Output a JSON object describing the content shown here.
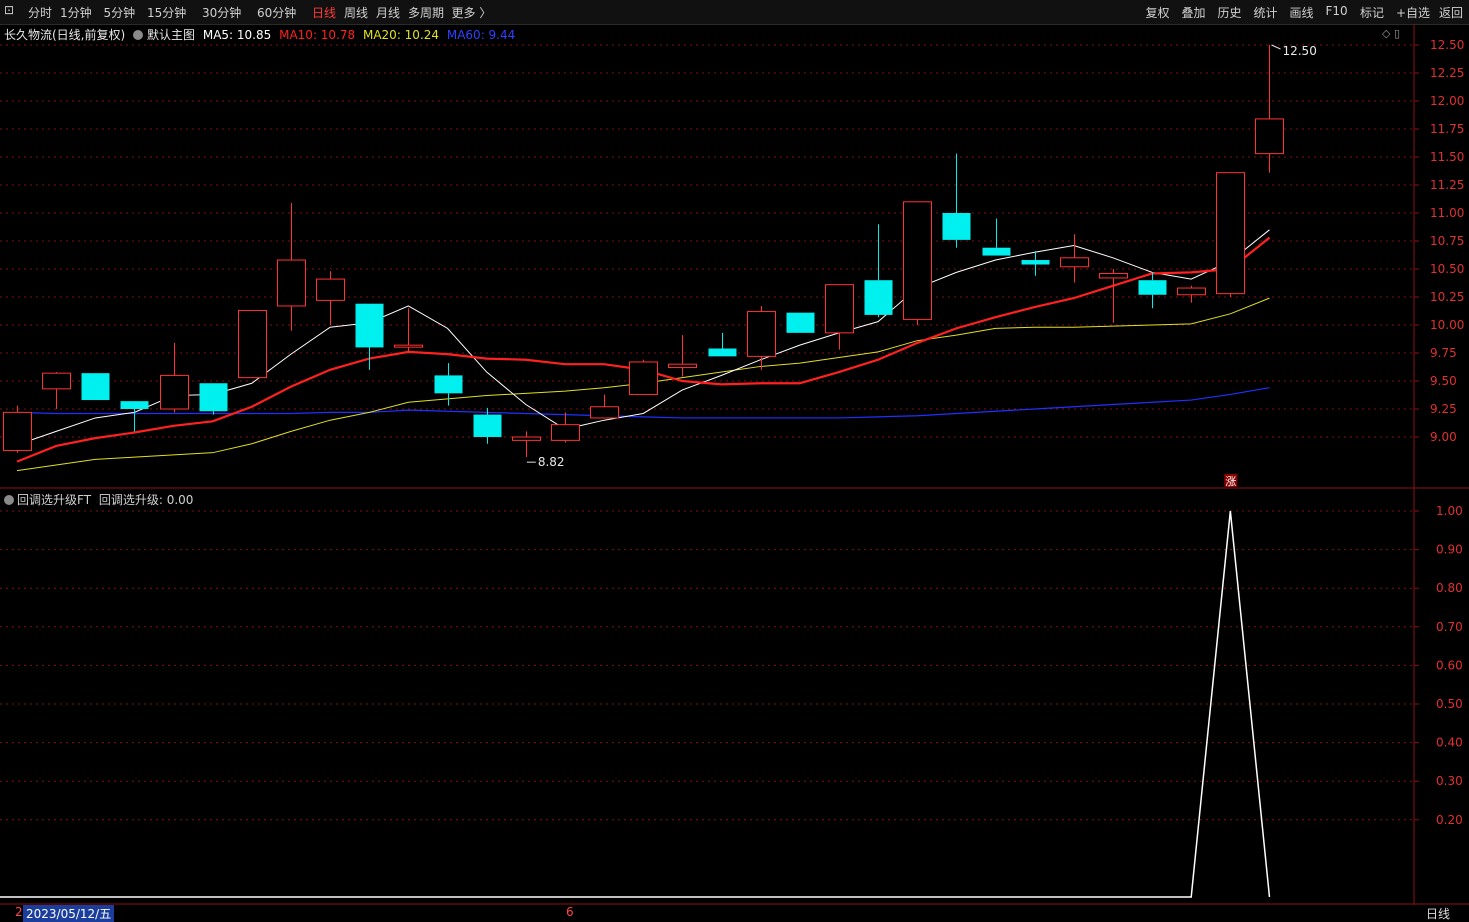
{
  "toolbar": {
    "periods": [
      "分时",
      "1分钟",
      "5分钟",
      "15分钟",
      "30分钟",
      "60分钟",
      "日线",
      "周线",
      "月线",
      "多周期",
      "更多 〉"
    ],
    "active_period": "日线",
    "right_buttons": [
      "复权",
      "叠加",
      "历史",
      "统计",
      "画线",
      "F10",
      "标记",
      "+自选",
      "返回"
    ]
  },
  "legend": {
    "stock": "长久物流(日线,前复权)",
    "template": "默认主图",
    "ma5": "MA5: 10.85",
    "ma10": "MA10: 10.78",
    "ma20": "MA20: 10.24",
    "ma60": "MA60: 9.44"
  },
  "indicator": {
    "name": "回调选升级FT",
    "value": "回调选升级: 0.00"
  },
  "annotations": {
    "high": "12.50",
    "low": "8.82",
    "signal": "涨"
  },
  "bottom": {
    "left_mark": "2",
    "date": "2023/05/12/五",
    "month_mark": "6",
    "period_label": "日线"
  },
  "colors": {
    "up": "#ff3232",
    "down": "#00f0f0",
    "ma5": "#ffffff",
    "ma10": "#ff2020",
    "ma20": "#e0e020",
    "ma60": "#2030ff",
    "border": "#8b1010"
  },
  "chart_data": [
    {
      "type": "candlestick",
      "y_ticks": [
        "12.50",
        "12.25",
        "12.00",
        "11.75",
        "11.50",
        "11.25",
        "11.00",
        "10.75",
        "10.50",
        "10.25",
        "10.00",
        "9.75",
        "9.50",
        "9.25",
        "9.00"
      ],
      "ylim": [
        8.7,
        12.55
      ],
      "candles": [
        {
          "o": 8.88,
          "c": 9.22,
          "h": 9.28,
          "l": 8.86
        },
        {
          "o": 9.43,
          "c": 9.57,
          "h": 9.58,
          "l": 9.25
        },
        {
          "o": 9.57,
          "c": 9.33,
          "h": 9.57,
          "l": 9.33
        },
        {
          "o": 9.32,
          "c": 9.25,
          "h": 9.32,
          "l": 9.05
        },
        {
          "o": 9.25,
          "c": 9.55,
          "h": 9.84,
          "l": 9.22
        },
        {
          "o": 9.48,
          "c": 9.23,
          "h": 9.48,
          "l": 9.2
        },
        {
          "o": 9.53,
          "c": 10.13,
          "h": 10.13,
          "l": 9.53
        },
        {
          "o": 10.17,
          "c": 10.58,
          "h": 11.09,
          "l": 9.95
        },
        {
          "o": 10.22,
          "c": 10.41,
          "h": 10.48,
          "l": 10.0
        },
        {
          "o": 10.19,
          "c": 9.8,
          "h": 10.19,
          "l": 9.6
        },
        {
          "o": 9.82,
          "c": 9.82,
          "h": 10.15,
          "l": 9.76
        },
        {
          "o": 9.55,
          "c": 9.39,
          "h": 9.66,
          "l": 9.28
        },
        {
          "o": 9.2,
          "c": 9.0,
          "h": 9.26,
          "l": 8.94
        },
        {
          "o": 8.97,
          "c": 9.0,
          "h": 9.05,
          "l": 8.82
        },
        {
          "o": 8.97,
          "c": 9.11,
          "h": 9.22,
          "l": 8.95
        },
        {
          "o": 9.17,
          "c": 9.27,
          "h": 9.38,
          "l": 9.17
        },
        {
          "o": 9.38,
          "c": 9.67,
          "h": 9.69,
          "l": 9.38
        },
        {
          "o": 9.62,
          "c": 9.65,
          "h": 9.91,
          "l": 9.54
        },
        {
          "o": 9.79,
          "c": 9.72,
          "h": 9.93,
          "l": 9.72
        },
        {
          "o": 9.72,
          "c": 10.12,
          "h": 10.17,
          "l": 9.6
        },
        {
          "o": 10.11,
          "c": 9.93,
          "h": 10.11,
          "l": 9.93
        },
        {
          "o": 9.93,
          "c": 10.36,
          "h": 10.36,
          "l": 9.78
        },
        {
          "o": 10.4,
          "c": 10.09,
          "h": 10.9,
          "l": 10.07
        },
        {
          "o": 10.05,
          "c": 11.1,
          "h": 11.1,
          "l": 10.0
        },
        {
          "o": 11.0,
          "c": 10.76,
          "h": 11.53,
          "l": 10.69
        },
        {
          "o": 10.69,
          "c": 10.62,
          "h": 10.95,
          "l": 10.62
        },
        {
          "o": 10.58,
          "c": 10.54,
          "h": 10.66,
          "l": 10.44
        },
        {
          "o": 10.52,
          "c": 10.6,
          "h": 10.81,
          "l": 10.38
        },
        {
          "o": 10.42,
          "c": 10.46,
          "h": 10.5,
          "l": 10.02
        },
        {
          "o": 10.4,
          "c": 10.27,
          "h": 10.47,
          "l": 10.15
        },
        {
          "o": 10.27,
          "c": 10.33,
          "h": 10.35,
          "l": 10.2
        },
        {
          "o": 10.28,
          "c": 11.36,
          "h": 11.36,
          "l": 10.25
        },
        {
          "o": 11.53,
          "c": 11.84,
          "h": 12.5,
          "l": 11.36
        }
      ],
      "ma5": [
        8.93,
        9.05,
        9.17,
        9.22,
        9.37,
        9.38,
        9.48,
        9.74,
        9.98,
        10.02,
        10.17,
        9.97,
        9.58,
        9.29,
        9.07,
        9.15,
        9.21,
        9.42,
        9.55,
        9.69,
        9.82,
        9.93,
        10.03,
        10.33,
        10.47,
        10.58,
        10.65,
        10.71,
        10.6,
        10.47,
        10.41,
        10.57,
        10.85
      ],
      "ma10": [
        8.78,
        8.92,
        8.99,
        9.04,
        9.1,
        9.14,
        9.27,
        9.45,
        9.6,
        9.7,
        9.76,
        9.74,
        9.7,
        9.69,
        9.65,
        9.65,
        9.6,
        9.5,
        9.47,
        9.48,
        9.48,
        9.58,
        9.69,
        9.84,
        9.97,
        10.07,
        10.16,
        10.24,
        10.35,
        10.46,
        10.47,
        10.5,
        10.78
      ],
      "ma20": [
        8.7,
        8.75,
        8.8,
        8.82,
        8.84,
        8.86,
        8.94,
        9.05,
        9.15,
        9.22,
        9.31,
        9.34,
        9.37,
        9.39,
        9.41,
        9.44,
        9.48,
        9.53,
        9.58,
        9.63,
        9.66,
        9.71,
        9.76,
        9.86,
        9.91,
        9.97,
        9.98,
        9.98,
        9.99,
        10.0,
        10.01,
        10.1,
        10.24
      ],
      "ma60": [
        9.22,
        9.21,
        9.21,
        9.21,
        9.21,
        9.21,
        9.21,
        9.21,
        9.22,
        9.22,
        9.24,
        9.23,
        9.22,
        9.21,
        9.2,
        9.19,
        9.18,
        9.17,
        9.17,
        9.17,
        9.17,
        9.17,
        9.18,
        9.19,
        9.21,
        9.23,
        9.25,
        9.27,
        9.29,
        9.31,
        9.33,
        9.38,
        9.44
      ]
    },
    {
      "type": "line",
      "y_ticks": [
        "1.00",
        "0.90",
        "0.80",
        "0.70",
        "0.60",
        "0.50",
        "0.40",
        "0.30",
        "0.20"
      ],
      "ylim": [
        0,
        1.0
      ],
      "values": [
        0,
        0,
        0,
        0,
        0,
        0,
        0,
        0,
        0,
        0,
        0,
        0,
        0,
        0,
        0,
        0,
        0,
        0,
        0,
        0,
        0,
        0,
        0,
        0,
        0,
        0,
        0,
        0,
        0,
        0,
        0,
        1.0,
        0
      ]
    }
  ]
}
